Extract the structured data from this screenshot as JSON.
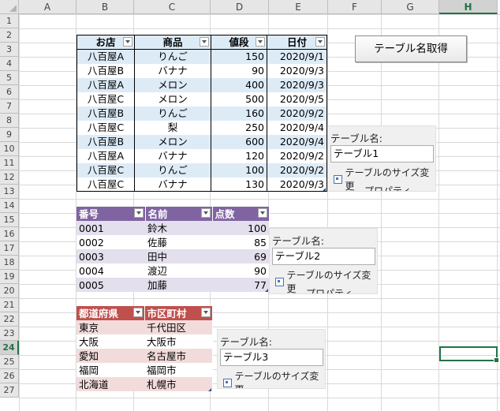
{
  "columns": [
    "A",
    "B",
    "C",
    "D",
    "E",
    "F",
    "G",
    "H"
  ],
  "rows": [
    "1",
    "2",
    "3",
    "4",
    "5",
    "6",
    "7",
    "8",
    "9",
    "10",
    "11",
    "12",
    "13",
    "14",
    "15",
    "16",
    "17",
    "18",
    "19",
    "20",
    "21",
    "22",
    "23",
    "24",
    "25",
    "26",
    "27"
  ],
  "selected_column": "H",
  "selected_row": "24",
  "button_label": "テーブル名取得",
  "table1": {
    "headers": [
      "お店",
      "商品",
      "値段",
      "日付"
    ],
    "rows": [
      [
        "八百屋A",
        "りんご",
        "150",
        "2020/9/1"
      ],
      [
        "八百屋B",
        "バナナ",
        "90",
        "2020/9/3"
      ],
      [
        "八百屋A",
        "メロン",
        "400",
        "2020/9/3"
      ],
      [
        "八百屋C",
        "メロン",
        "500",
        "2020/9/5"
      ],
      [
        "八百屋B",
        "りんご",
        "160",
        "2020/9/2"
      ],
      [
        "八百屋C",
        "梨",
        "250",
        "2020/9/4"
      ],
      [
        "八百屋B",
        "メロン",
        "600",
        "2020/9/4"
      ],
      [
        "八百屋A",
        "バナナ",
        "120",
        "2020/9/2"
      ],
      [
        "八百屋C",
        "りんご",
        "100",
        "2020/9/2"
      ],
      [
        "八百屋C",
        "バナナ",
        "130",
        "2020/9/3"
      ]
    ],
    "header_color": "#ddebf7",
    "band_color": "#ddebf7"
  },
  "table2": {
    "headers": [
      "番号",
      "名前",
      "点数"
    ],
    "rows": [
      [
        "0001",
        "鈴木",
        "100"
      ],
      [
        "0002",
        "佐藤",
        "85"
      ],
      [
        "0003",
        "田中",
        "69"
      ],
      [
        "0004",
        "渡辺",
        "90"
      ],
      [
        "0005",
        "加藤",
        "77"
      ]
    ],
    "header_color": "#8064a2",
    "band_color": "#e4dfec"
  },
  "table3": {
    "headers": [
      "都道府県",
      "市区町村"
    ],
    "rows": [
      [
        "東京",
        "千代田区"
      ],
      [
        "大阪",
        "大阪市"
      ],
      [
        "愛知",
        "名古屋市"
      ],
      [
        "福岡",
        "福岡市"
      ],
      [
        "北海道",
        "札幌市"
      ]
    ],
    "header_color": "#c0504d",
    "band_color": "#f2dcdb"
  },
  "panel1": {
    "label": "テーブル名:",
    "value": "テーブル1",
    "resize": "テーブルのサイズ変更",
    "properties": "プロパティ"
  },
  "panel2": {
    "label": "テーブル名:",
    "value": "テーブル2",
    "resize": "テーブルのサイズ変更",
    "properties": "プロパティ"
  },
  "panel3": {
    "label": "テーブル名:",
    "value": "テーブル3",
    "resize": "テーブルのサイズ変更"
  },
  "accent": "#217346"
}
